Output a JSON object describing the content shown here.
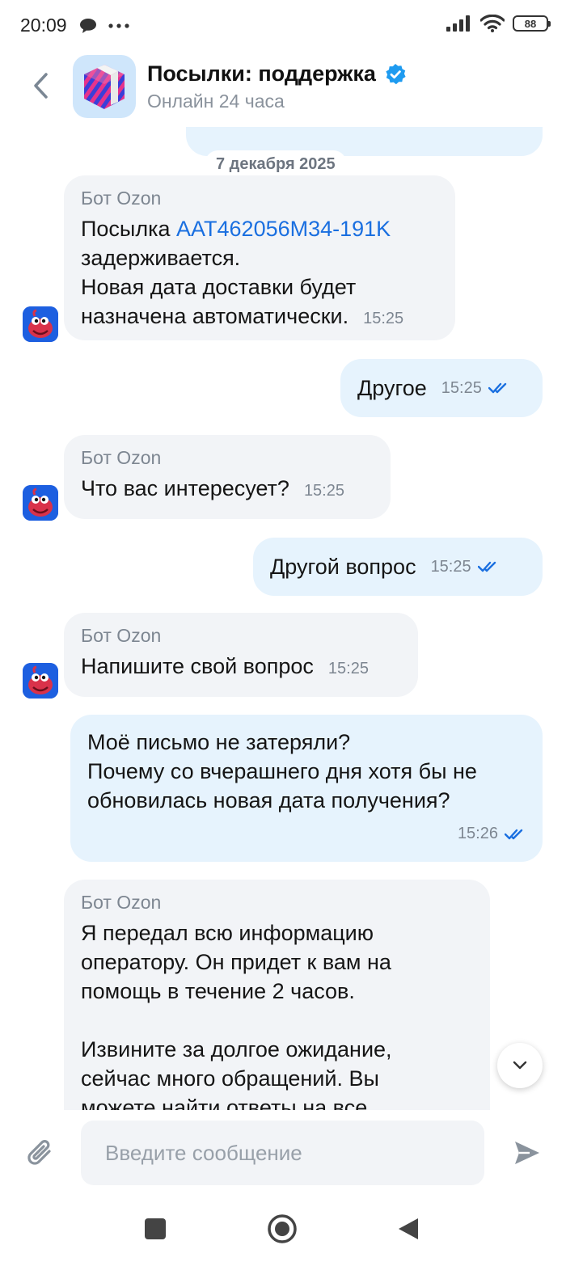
{
  "status_bar": {
    "time": "20:09",
    "battery": "88"
  },
  "header": {
    "title": "Посылки: поддержка",
    "subtitle": "Онлайн 24 часа",
    "verified_color": "#1e9bf0"
  },
  "chat": {
    "date_separator": "7 декабря 2025",
    "messages": [
      {
        "direction": "in",
        "sender": "Бот Ozon",
        "text_before_link": "Посылка ",
        "link": "AAT462056M34-191K",
        "text_after_link": "задерживается.\nНовая дата доставки будет\nназначена автоматически.",
        "time": "15:25"
      },
      {
        "direction": "out",
        "text": "Другое",
        "time": "15:25",
        "status": "read"
      },
      {
        "direction": "in",
        "sender": "Бот Ozon",
        "text": "Что вас интересует?",
        "time": "15:25"
      },
      {
        "direction": "out",
        "text": "Другой вопрос",
        "time": "15:25",
        "status": "read"
      },
      {
        "direction": "in",
        "sender": "Бот Ozon",
        "text": "Напишите свой вопрос",
        "time": "15:25"
      },
      {
        "direction": "out",
        "text": "Моё письмо не затеряли?\nПочему со вчерашнего дня хотя бы не\nобновилась новая дата получения?",
        "time": "15:26",
        "status": "read"
      },
      {
        "direction": "in",
        "sender": "Бот Ozon",
        "text": "Я передал всю информацию\nоператору. Он придет к вам на\nпомощь в течение 2 часов.\n\nИзвините за долгое ожидание,\nсейчас много обращений. Вы\nможете найти ответы на все"
      }
    ]
  },
  "composer": {
    "placeholder": "Введите сообщение"
  },
  "colors": {
    "incoming_bubble": "#f2f4f7",
    "outgoing_bubble": "#e6f3fd",
    "link": "#1a6fe0",
    "read_ticks": "#1a6fe0"
  }
}
